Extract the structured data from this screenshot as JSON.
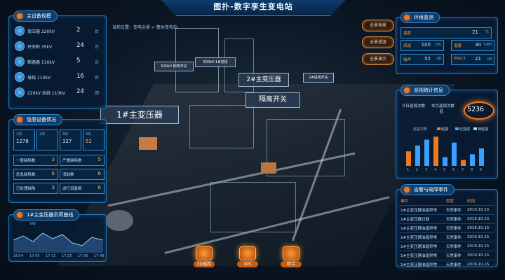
{
  "title": "图扑-数字孪生变电站",
  "breadcrumb": "当前位置：变电全景 > 整体变电站",
  "colors": {
    "accent": "#2b8ad6",
    "orange": "#f07820",
    "bg": "#06101f"
  },
  "left_top": {
    "title": "主设备规模",
    "items": [
      {
        "label": "变压器 220kV",
        "value": "2",
        "unit": "台"
      },
      {
        "label": "开关柜 35kV",
        "value": "24",
        "unit": "台"
      },
      {
        "label": "断路器 110kV",
        "value": "5",
        "unit": "台"
      },
      {
        "label": "母线 110kV",
        "value": "16",
        "unit": "台"
      },
      {
        "label": "220kV 出线 110kV",
        "value": "24",
        "unit": "回"
      }
    ]
  },
  "left_mid": {
    "title": "隐患设备情况",
    "top_boxes": [
      {
        "label": "1月",
        "value": "1278"
      },
      {
        "label": "2月",
        "value": ""
      },
      {
        "label": "3月",
        "value": "327"
      },
      {
        "label": "4月",
        "value": "52"
      }
    ],
    "rows": [
      {
        "label": "一般缺陷数",
        "value": "3"
      },
      {
        "label": "严重缺陷数",
        "value": "5"
      },
      {
        "label": "危急缺陷数",
        "value": "6"
      },
      {
        "label": "消缺数",
        "value": "6"
      },
      {
        "label": "已处理缺陷",
        "value": "3"
      },
      {
        "label": "运行设备数",
        "value": "6"
      }
    ]
  },
  "left_bottom": {
    "title": "1#主变压器负荷曲线",
    "y_label": "kW",
    "x_labels": [
      "16:54",
      "17:05",
      "17:15",
      "17:25",
      "17:35",
      "17:48"
    ]
  },
  "right_top": {
    "title": "环境监测",
    "rows": [
      {
        "label": "温度",
        "value": "21",
        "unit": "℃"
      },
      {
        "label": "风速",
        "value": "100",
        "unit": "r/m"
      },
      {
        "label": "湿度",
        "value": "30",
        "unit": "%RH"
      },
      {
        "label": "噪声",
        "value": "52",
        "unit": "dB"
      },
      {
        "label": "PM2.5",
        "value": "21",
        "unit": "μg"
      }
    ]
  },
  "right_mid": {
    "title": "巡视统计信息",
    "left_label": "今日巡视次数",
    "left_value": "",
    "mid_label": "本月巡视次数",
    "mid_value": "6",
    "big_value": "5236",
    "chart_title": "巡视次数",
    "legend": [
      "巡视",
      "已完成",
      "待巡视"
    ],
    "x_labels": [
      "1",
      "2",
      "3",
      "4",
      "5",
      "6",
      "7",
      "8",
      "9"
    ],
    "bars": [
      5,
      7,
      9,
      10,
      3,
      8,
      2,
      4,
      6
    ]
  },
  "right_bottom": {
    "title": "告警与故障事件",
    "headers": [
      "事件",
      "类型",
      "时间"
    ],
    "rows": [
      [
        "1#主变压器油温异常",
        "天然事件",
        "2019.10.15"
      ],
      [
        "1#主变压器过载",
        "天然事件",
        "2019.10.15"
      ],
      [
        "1#主变压器油温异常",
        "天然事件",
        "2019.10.15"
      ],
      [
        "1#主变压器油温异常",
        "天然事件",
        "2019.10.15"
      ],
      [
        "1#主变压器油温异常",
        "天然事件",
        "2019.10.15"
      ],
      [
        "1#主变压器油温异常",
        "天然事件",
        "2019.10.15"
      ],
      [
        "1#主变压器油温异常",
        "天然事件",
        "2019.10.15"
      ]
    ]
  },
  "nav_buttons": [
    "全景场景",
    "全景漫游",
    "全景演示"
  ],
  "scene_labels": {
    "t1": "1#主变压器",
    "t2": "2#主变压器",
    "sw": "隔离开关",
    "line1": "500kV 即将开关",
    "line2": "500kV 1#进线",
    "line3": "1#进线开关"
  },
  "bottom_buttons": [
    "3D巡检",
    "GIS",
    "综合"
  ]
}
